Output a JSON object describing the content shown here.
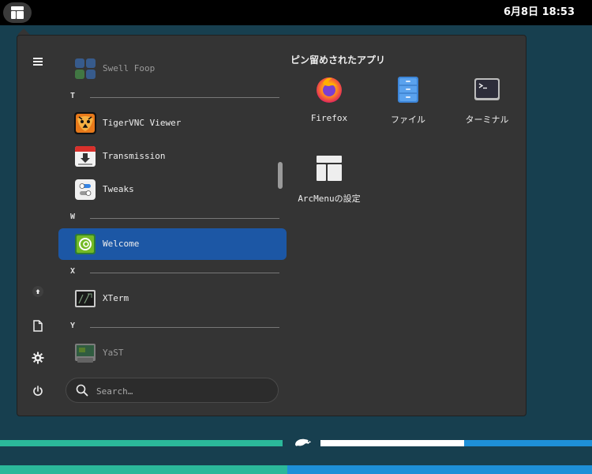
{
  "topbar": {
    "clock": "6月8日  18:53",
    "activities_icon": "arcmenu-layout-icon"
  },
  "menu": {
    "sidebar": [
      {
        "name": "hamburger-menu-icon"
      },
      {
        "name": "home-icon"
      },
      {
        "name": "document-icon"
      },
      {
        "name": "settings-gear-icon"
      },
      {
        "name": "power-icon"
      }
    ],
    "apps": [
      {
        "label": "Swell Foop",
        "icon": "swell-foop-icon",
        "faded": true
      },
      {
        "section": "T"
      },
      {
        "label": "TigerVNC Viewer",
        "icon": "tigervnc-icon"
      },
      {
        "label": "Transmission",
        "icon": "transmission-icon"
      },
      {
        "label": "Tweaks",
        "icon": "tweaks-icon"
      },
      {
        "section": "W"
      },
      {
        "label": "Welcome",
        "icon": "welcome-icon",
        "selected": true
      },
      {
        "section": "X"
      },
      {
        "label": "XTerm",
        "icon": "xterm-icon"
      },
      {
        "section": "Y"
      },
      {
        "label": "YaST",
        "icon": "yast-icon",
        "faded": true
      }
    ],
    "search": {
      "placeholder": "Search…",
      "value": ""
    },
    "pinned": {
      "title": "ピン留めされたアプリ",
      "items": [
        {
          "label": "Firefox",
          "icon": "firefox-icon"
        },
        {
          "label": "ファイル",
          "icon": "files-icon"
        },
        {
          "label": "ターミナル",
          "icon": "terminal-icon"
        },
        {
          "label": "ArcMenuの設定",
          "icon": "arcmenu-settings-icon"
        }
      ]
    }
  },
  "colors": {
    "selected": "#1c57a5",
    "panel": "#343434",
    "wallpaper": "#173f4f",
    "teal": "#2bb89a",
    "blue": "#1e90d8"
  }
}
